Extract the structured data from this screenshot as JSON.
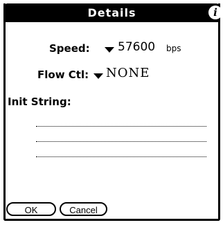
{
  "dialog": {
    "title": "Details",
    "info_icon": "info-icon"
  },
  "speed": {
    "label": "Speed:",
    "value": "57600",
    "unit": "bps"
  },
  "flow_control": {
    "label": "Flow Ctl:",
    "value": "NONE"
  },
  "init_string": {
    "label": "Init String:",
    "value": ""
  },
  "buttons": {
    "ok": "OK",
    "cancel": "Cancel"
  }
}
